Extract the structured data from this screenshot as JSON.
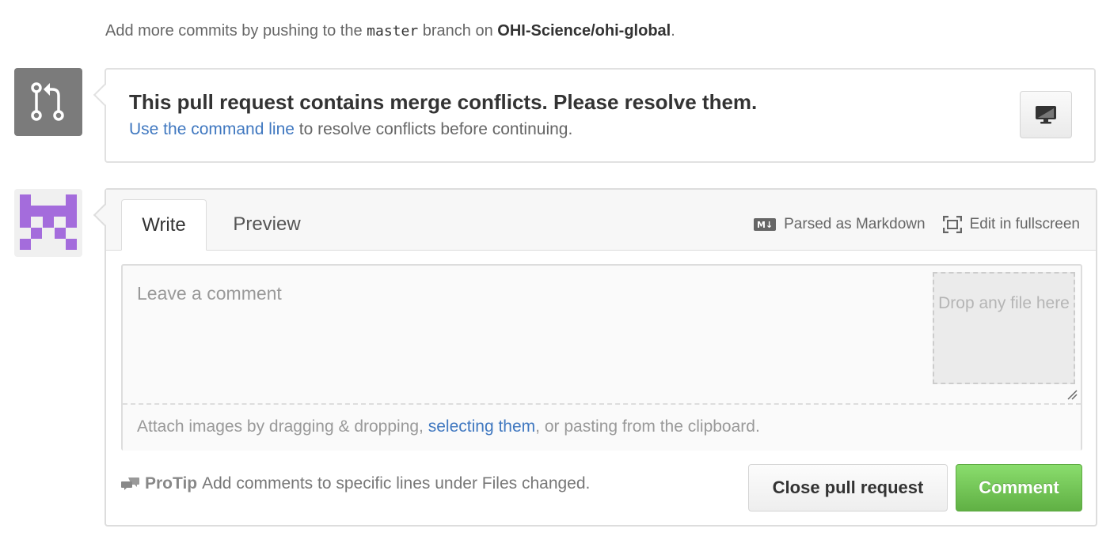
{
  "top_note": {
    "prefix": "Add more commits by pushing to the",
    "branch": "master",
    "middle": "branch on",
    "repo": "OHI-Science/ohi-global",
    "suffix": "."
  },
  "merge": {
    "icon": "git-pull-request-icon",
    "title": "This pull request contains merge conflicts. Please resolve them.",
    "desc_link": "Use the command line",
    "desc_rest": "to resolve conflicts before continuing.",
    "cli_button_icon": "desktop-icon"
  },
  "comment_form": {
    "tabs": [
      {
        "label": "Write",
        "active": true
      },
      {
        "label": "Preview",
        "active": false
      }
    ],
    "parsed_as": "Parsed as Markdown",
    "fullscreen": "Edit in fullscreen",
    "textarea_placeholder": "Leave a comment",
    "drop_zone": "Drop any file here",
    "attach_prefix": "Attach images by dragging & dropping,",
    "attach_link": "selecting them",
    "attach_suffix": ", or pasting from the clipboard.",
    "protip_label": "ProTip",
    "protip_text": "Add comments to specific lines under Files changed.",
    "close_button": "Close pull request",
    "comment_button": "Comment"
  },
  "colors": {
    "link": "#4078c0",
    "primary_button": "#60b044",
    "avatar": "#a46cdc",
    "merge_icon_bg": "#7b7b7b"
  }
}
